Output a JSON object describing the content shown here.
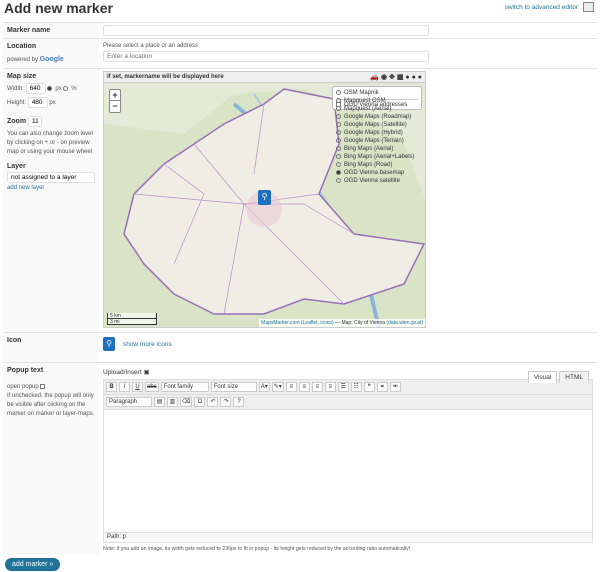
{
  "page_title": "Add new marker",
  "advanced_link": "switch to advanced editor",
  "marker_name": {
    "label": "Marker name",
    "value": ""
  },
  "location": {
    "label": "Location",
    "powered_by": "powered by",
    "google": "Google",
    "hint": "Please select a place or an address",
    "placeholder": "Enter a location"
  },
  "map_size": {
    "label": "Map size",
    "width_label": "Width:",
    "width": "640",
    "px": "px",
    "pct": "%",
    "height_label": "Height:",
    "height": "480",
    "height_unit": "px"
  },
  "zoom": {
    "label": "Zoom",
    "value": "11",
    "help": "You can also change zoom level by clicking on + or - on preview map or using your mouse wheel"
  },
  "layer": {
    "label": "Layer",
    "value": "not assigned to a layer",
    "add_link": "add new layer"
  },
  "map": {
    "header": "if set, markername will be displayed here",
    "zoom_in": "+",
    "zoom_out": "−",
    "layers": [
      "OSM Mapnik",
      "Mapquest OSM",
      "Mapquest (Aerial)",
      "Google Maps (Roadmap)",
      "Google Maps (Satellite)",
      "Google Maps (Hybrid)",
      "Google Maps (Terrain)",
      "Bing Maps (Aerial)",
      "Bing Maps (Aerial+Labels)",
      "Bing Maps (Road)",
      "OGD Vienna basemap",
      "OGD Vienna satellite"
    ],
    "selected_layer": "OGD Vienna basemap",
    "overlay": "OGD Vienna addresses",
    "scale_km": "5 km",
    "scale_mi": "3 mi",
    "attrib_link": "MapsMarker.com (Leaflet, icons)",
    "attrib_text": " — Map: City of Vienna ",
    "attrib_link2": "(data.wien.gv.at)"
  },
  "icon": {
    "label": "Icon",
    "show_more": "show more icons"
  },
  "popup": {
    "label": "Popup text",
    "open_label": "open popup",
    "help": "If unchecked, the popup will only be visible after clicking on the marker on marker or layer-maps.",
    "upload": "Upload/Insert",
    "tab_visual": "Visual",
    "tab_html": "HTML",
    "font_family": "Font family",
    "font_size": "Font size",
    "paragraph": "Paragraph",
    "path": "Path: p",
    "note": "Note: if you add an image, its width gets reduced to 230px to fit in popup - its height gets reduced by the according ratio automatically!"
  },
  "submit": "add marker »"
}
